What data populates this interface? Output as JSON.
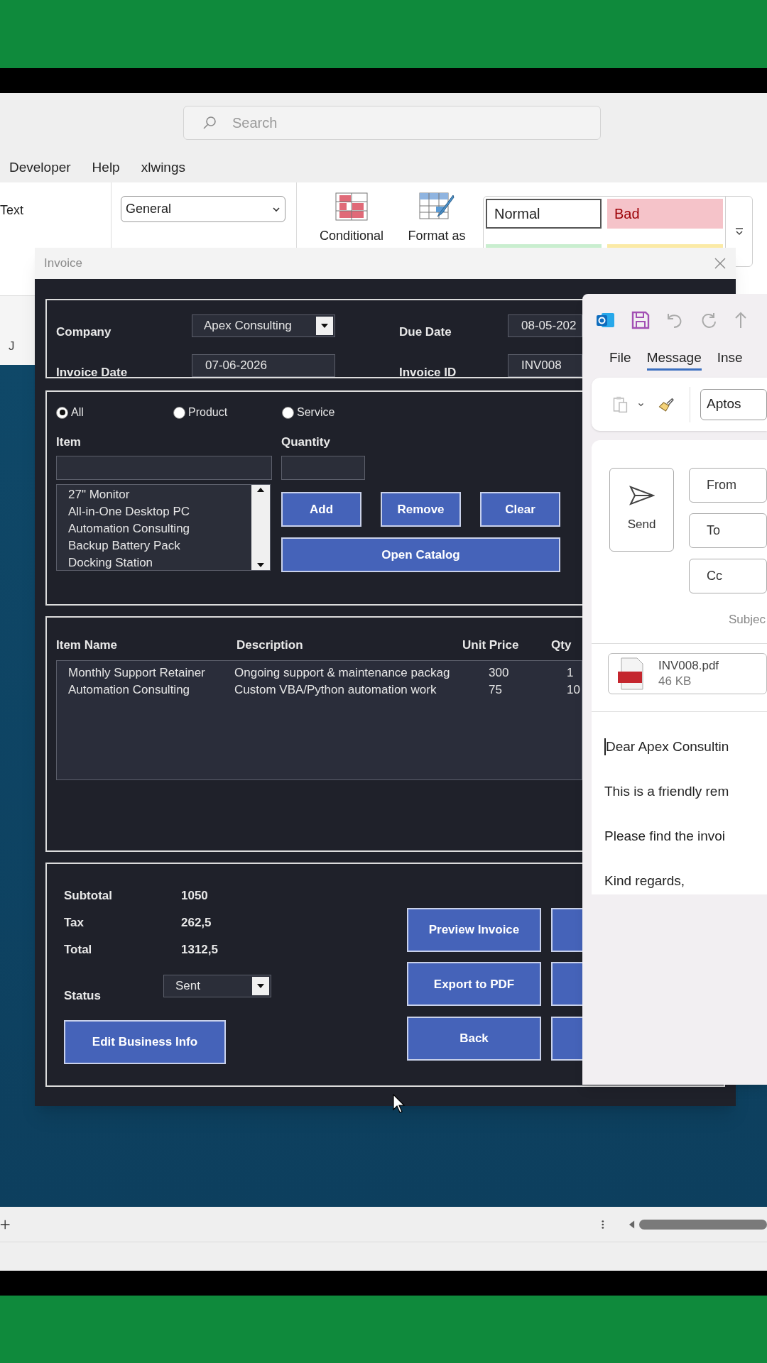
{
  "excel": {
    "search": {
      "placeholder": "Search"
    },
    "menu_tabs": [
      "Developer",
      "Help",
      "xlwings"
    ],
    "alignment_label": "Text",
    "number_format": "General",
    "format_buttons": [
      {
        "kind": "conditional",
        "label": "Conditional"
      },
      {
        "kind": "table",
        "label": "Format as"
      }
    ],
    "cell_styles": [
      {
        "label": "Normal",
        "color": "#ffffff"
      },
      {
        "label": "Bad",
        "color": "#f5c3c9"
      },
      {
        "color": "#c9eecf"
      },
      {
        "color": "#fbeaa6"
      }
    ],
    "column_header": "J"
  },
  "invoice_dialog": {
    "title": "Invoice",
    "header_fields": [
      {
        "label": "Company",
        "value": "Apex Consulting",
        "kind": "dropdown"
      },
      {
        "label": "Due Date",
        "value": "08-05-202",
        "kind": "text"
      },
      {
        "label": "Invoice Date",
        "value": "07-06-2026",
        "kind": "text"
      },
      {
        "label": "Invoice ID",
        "value": "INV008",
        "kind": "text"
      }
    ],
    "filters": [
      {
        "label": "All",
        "selected": true
      },
      {
        "label": "Product",
        "selected": false
      },
      {
        "label": "Service",
        "selected": false
      }
    ],
    "item_label": "Item",
    "quantity_label": "Quantity",
    "catalog_items": [
      "27\" Monitor",
      "All-in-One Desktop PC",
      "Automation Consulting",
      "Backup Battery Pack",
      "Docking Station"
    ],
    "item_buttons": [
      "Add",
      "Remove",
      "Clear"
    ],
    "catalog_button": "Open Catalog",
    "table": {
      "columns": [
        "Item Name",
        "Description",
        "Unit Price",
        "Qty"
      ],
      "rows": [
        [
          "Monthly Support Retainer",
          "Ongoing support & maintenance packag",
          "300",
          "1"
        ],
        [
          "Automation Consulting",
          "Custom VBA/Python automation work",
          "75",
          "10"
        ]
      ]
    },
    "totals": [
      {
        "label": "Subtotal",
        "value": "1050"
      },
      {
        "label": "Tax",
        "value": "262,5"
      },
      {
        "label": "Total",
        "value": "1312,5"
      }
    ],
    "status": {
      "label": "Status",
      "value": "Sent"
    },
    "edit_button": "Edit Business Info",
    "action_buttons": [
      "Preview Invoice",
      "Export to PDF",
      "Back"
    ]
  },
  "outlook": {
    "tabs": [
      {
        "label": "File",
        "selected": false
      },
      {
        "label": "Message",
        "selected": true
      },
      {
        "label": "Inse",
        "selected": false
      }
    ],
    "font": "Aptos",
    "send_button": "Send",
    "address_buttons": [
      "From",
      "To",
      "Cc"
    ],
    "subject_label": "Subjec",
    "attachment": {
      "name": "INV008.pdf",
      "size": "46 KB"
    },
    "body_lines": [
      "Dear Apex Consultin",
      "This is a friendly rem",
      "Please find the invoi",
      "Kind regards,"
    ]
  }
}
